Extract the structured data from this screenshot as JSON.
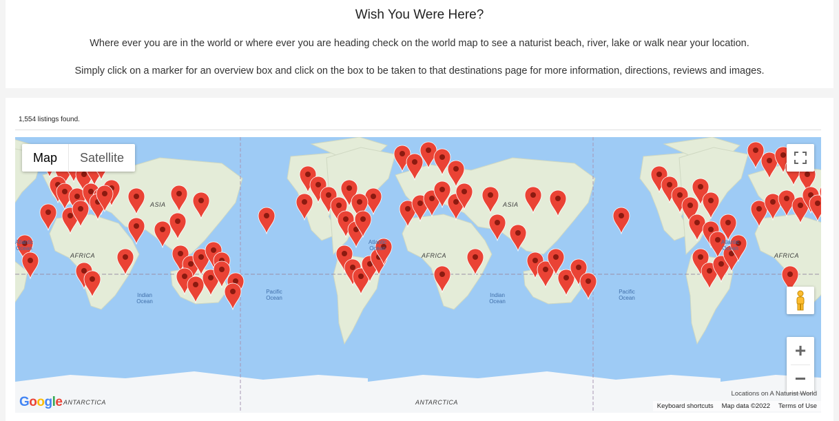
{
  "intro": {
    "title": "Wish You Were Here?",
    "line1": "Where ever you are in the world or where ever you are heading check on the world map to see a naturist beach, river, lake or walk near your location.",
    "line2": "Simply click on a marker for an overview box and click on the box to be taken to that destinations page for more information, directions, reviews and images."
  },
  "listing_count": "1,554 listings found.",
  "map": {
    "type_map": "Map",
    "type_satellite": "Satellite",
    "labels": {
      "asia": "ASIA",
      "africa": "AFRICA",
      "antarctica": "ANTARCTICA",
      "atlantic": "Atlantic Ocean",
      "indian": "Indian Ocean",
      "pacific": "Pacific Ocean"
    },
    "google": "Google",
    "locations_credit": "Locations on A Naturist World",
    "keyboard_shortcuts": "Keyboard shortcuts",
    "map_data": "Map data ©2022",
    "terms": "Terms of Use",
    "zoom_in": "+",
    "zoom_out": "−",
    "colors": {
      "water": "#9ecbf5",
      "land": "#e4ecd8",
      "marker": "#ea4335",
      "marker_dot": "#8b1a10"
    }
  }
}
